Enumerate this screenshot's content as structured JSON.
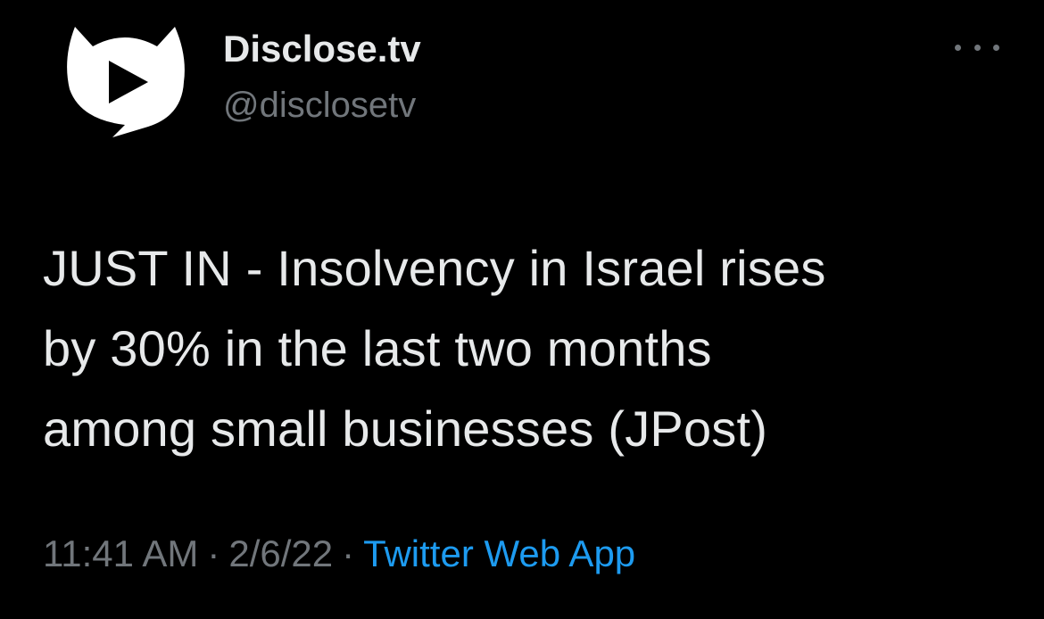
{
  "tweet": {
    "author": {
      "display_name": "Disclose.tv",
      "handle": "@disclosetv",
      "avatar_icon": "disclose-play-logo-icon"
    },
    "more_icon": "more-options-icon",
    "text_lines": [
      "JUST IN - Insolvency in Israel rises",
      "by 30% in the last two months",
      "among small businesses (JPost)"
    ],
    "meta": {
      "time": "11:41 AM",
      "separator": "·",
      "date": "2/6/22",
      "source": "Twitter Web App"
    }
  },
  "colors": {
    "background": "#000000",
    "primary_text": "#e7e9ea",
    "secondary_text": "#71767b",
    "link": "#1d9bf0"
  }
}
